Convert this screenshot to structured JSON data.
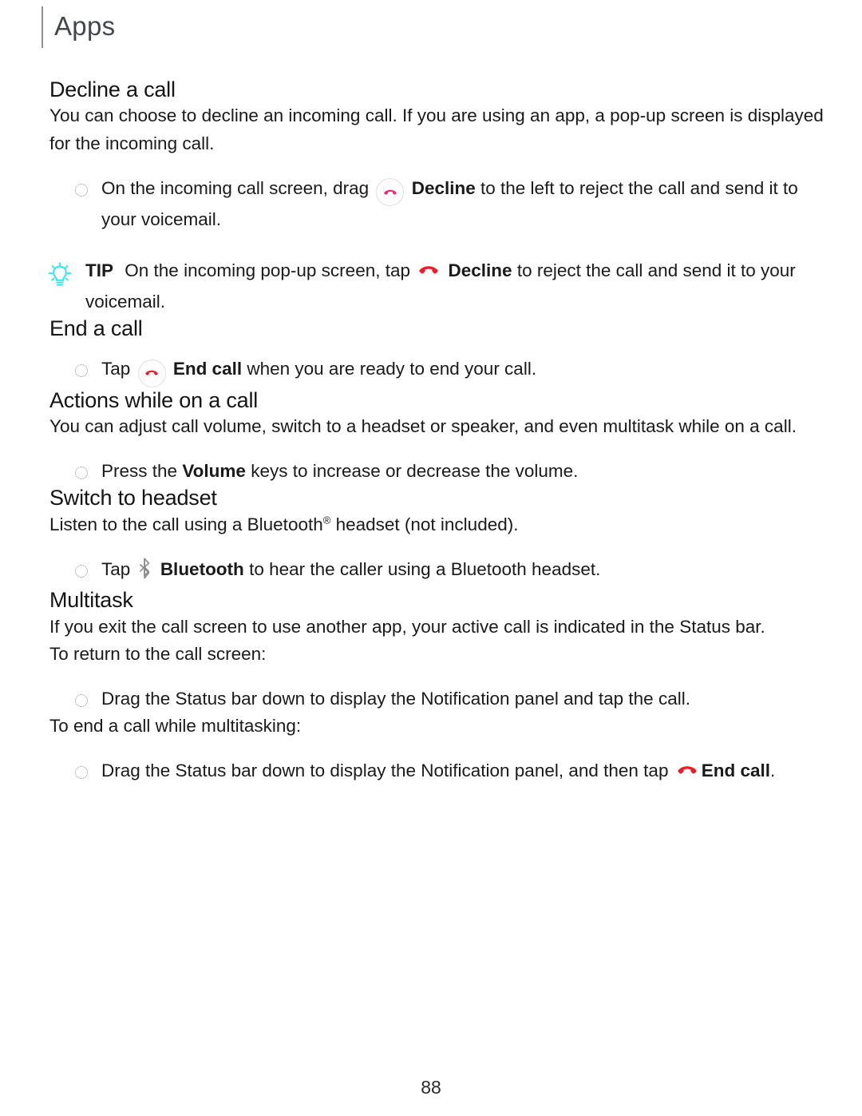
{
  "header": {
    "title": "Apps"
  },
  "icons": {
    "decline_pink": "phone-decline-icon",
    "decline_red": "phone-decline-icon",
    "end_call": "phone-end-call-icon",
    "tip_bulb": "lightbulb-icon",
    "bluetooth": "bluetooth-icon"
  },
  "colors": {
    "decline_pink": "#F5276B",
    "end_call_red": "#EE1C25",
    "tip_cyan": "#2FE6F2",
    "bluetooth_gray": "#8A8A8A",
    "heading": "#141414",
    "body": "#1A1A1A",
    "header_title": "#44484C",
    "header_rule": "#8C9196"
  },
  "sections": {
    "decline": {
      "heading": "Decline a call",
      "paragraph": "You can choose to decline an incoming call. If you are using an app, a pop-up screen is displayed for the incoming call.",
      "bullet": {
        "pre": "On the incoming call screen, drag",
        "bold": "Decline",
        "post": "to the left to reject the call and send it to your voicemail."
      },
      "tip": {
        "label": "TIP",
        "pre": "On the incoming pop-up screen, tap",
        "bold": "Decline",
        "post": "to reject the call and send it to your voicemail."
      }
    },
    "end_call": {
      "heading": "End a call",
      "bullet": {
        "pre": "Tap",
        "bold": "End call",
        "post": "when you are ready to end your call."
      }
    },
    "actions": {
      "heading": "Actions while on a call",
      "paragraph": "You can adjust call volume, switch to a headset or speaker, and even multitask while on a call.",
      "bullet": {
        "pre": "Press the",
        "bold": "Volume",
        "post": "keys to increase or decrease the volume."
      }
    },
    "headset": {
      "heading": "Switch to headset",
      "paragraph_pre": "Listen to the call using a Bluetooth",
      "paragraph_sup": "®",
      "paragraph_post": " headset (not included).",
      "bullet": {
        "pre": "Tap",
        "bold": "Bluetooth",
        "post": "to hear the caller using a Bluetooth headset."
      }
    },
    "multitask": {
      "heading": "Multitask",
      "paragraph": "If you exit the call screen to use another app, your active call is indicated in the Status bar.",
      "return_lead": "To return to the call screen:",
      "return_bullet": "Drag the Status bar down to display the Notification panel and tap the call.",
      "end_lead": "To end a call while multitasking:",
      "end_bullet": {
        "pre": "Drag the Status bar down to display the Notification panel, and then tap",
        "bold": "End call",
        "post": "."
      }
    }
  },
  "footer": {
    "page_number": "88"
  }
}
